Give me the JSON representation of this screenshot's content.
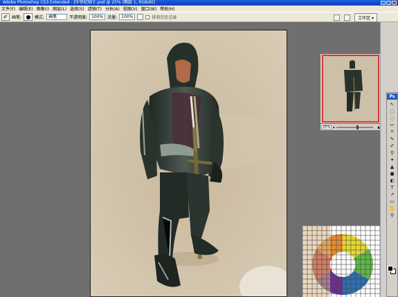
{
  "window": {
    "title": "Adobe Photoshop CS3 Extended - [中世纪骑士.psd @ 25% (图层 1, RGB/8)]"
  },
  "menu": {
    "items": [
      "文件(F)",
      "编辑(E)",
      "图像(I)",
      "图层(L)",
      "选择(S)",
      "滤镜(T)",
      "分析(A)",
      "视图(V)",
      "窗口(W)",
      "帮助(H)"
    ]
  },
  "options": {
    "brush_label": "画笔:",
    "mode_label": "模式:",
    "mode_value": "画笔",
    "opacity_label": "不透明度:",
    "opacity_value": "100%",
    "flow_label": "流量:",
    "flow_value": "100%",
    "history_label": "抹到历史记录",
    "workspace_label": "工作区 ▾"
  },
  "navigator": {
    "zoom": "25%"
  },
  "toolbox": {
    "logo": "Ps",
    "tools": [
      "↖",
      "⬚",
      "◌",
      "✂",
      "⌗",
      "✎",
      "✐",
      "⚲",
      "✦",
      "▲",
      "●",
      "◐",
      "T",
      "↗",
      "▭",
      "✋",
      "⚲"
    ]
  },
  "colors": {
    "canvas_bg": "#cdbfa8",
    "accent_red": "#d83a3a",
    "titlebar": "#0a3fb8"
  }
}
